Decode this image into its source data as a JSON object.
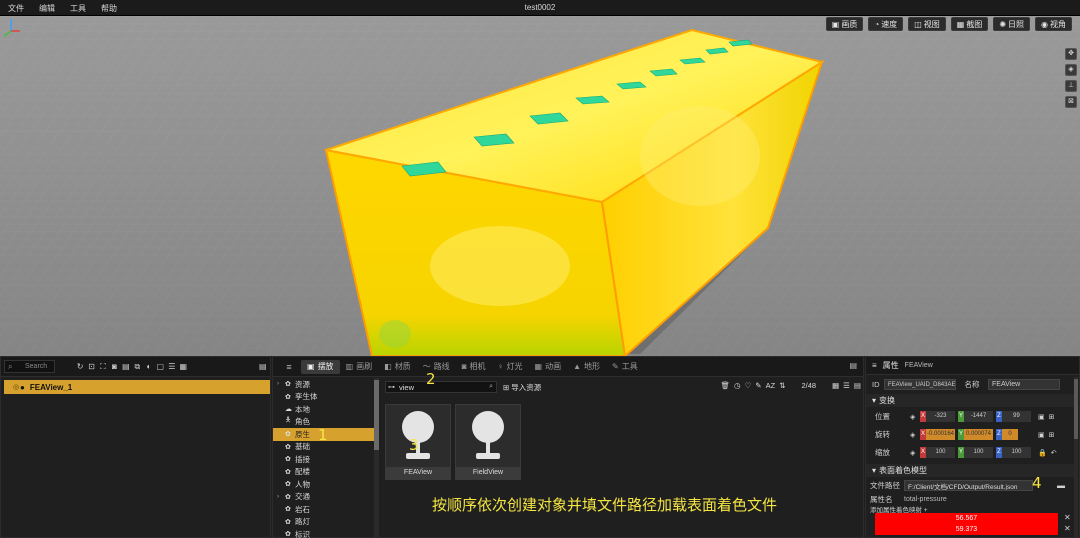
{
  "titlebar": {
    "menu": [
      "文件",
      "编辑",
      "工具",
      "帮助"
    ],
    "title": "test0002"
  },
  "viewport": {
    "toolbar": [
      {
        "icon": "image-icon",
        "label": "画质"
      },
      {
        "icon": "gauge-icon",
        "label": "速度"
      },
      {
        "icon": "view-icon",
        "label": "视图"
      },
      {
        "icon": "screenshot-icon",
        "label": "截图"
      },
      {
        "icon": "sun-icon",
        "label": "日照"
      },
      {
        "icon": "eye-icon",
        "label": "视角"
      }
    ],
    "colors": {
      "box": "#ffd400",
      "highlight": "#fff26a",
      "grid_bg": "#8d8d8d",
      "vent": "#2fd89a"
    }
  },
  "left_panel": {
    "search_placeholder": "Search",
    "selected_item": "FEAView_1"
  },
  "mid_panel": {
    "tabs": [
      "摆放",
      "画刷",
      "材质",
      "路线",
      "相机",
      "灯光",
      "动画",
      "地形",
      "工具"
    ],
    "tree": [
      {
        "label": "资源",
        "expandable": true
      },
      {
        "label": "孪生体",
        "expandable": false
      },
      {
        "label": "本地",
        "expandable": false
      },
      {
        "label": "角色",
        "expandable": false
      },
      {
        "label": "原生",
        "expandable": false,
        "selected": true
      },
      {
        "label": "基础",
        "expandable": false
      },
      {
        "label": "插接",
        "expandable": false
      },
      {
        "label": "配楼",
        "expandable": false
      },
      {
        "label": "人物",
        "expandable": false
      },
      {
        "label": "交通",
        "expandable": true
      },
      {
        "label": "岩石",
        "expandable": false
      },
      {
        "label": "路灯",
        "expandable": false
      },
      {
        "label": "标识",
        "expandable": false
      }
    ],
    "filter_value": "view",
    "import_label": "导入资源",
    "count": "2/48",
    "tiles": [
      "FEAView",
      "FieldView"
    ],
    "instruction": "按顺序依次创建对象并填文件路径加载表面着色文件",
    "markers": [
      "1",
      "2",
      "3",
      "4"
    ]
  },
  "right_panel": {
    "header": "属性",
    "header_value": "FEAView",
    "id_label": "ID",
    "id_value": "FEAView_UAID_D843AE",
    "name_label": "名称",
    "name_value": "FEAView",
    "transform_section": "变换",
    "position_label": "位置",
    "position": [
      "-323",
      "-1447",
      "99"
    ],
    "rotation_label": "旋转",
    "rotation": [
      "-0.000164",
      "0.000074",
      "0"
    ],
    "scale_label": "缩放",
    "scale": [
      "100",
      "100",
      "100"
    ],
    "surface_section": "表面着色模型",
    "file_path_label": "文件路径",
    "file_path": "F:/Client/文档/CFD/Output/Result.json",
    "attr_name_label": "属性名",
    "attr_name_value": "total-pressure",
    "add_map_label": "添加属性着色映射 +",
    "color_values": [
      "56.567",
      "59.373"
    ]
  }
}
